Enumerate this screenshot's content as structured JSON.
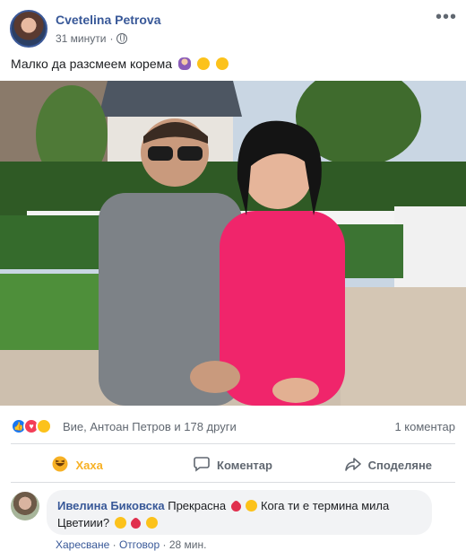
{
  "post": {
    "author": "Cvetelina Petrova",
    "time": "31 минути",
    "privacy_icon": "globe-icon",
    "more_label": "•••",
    "text": "Малко да разсмеем корема",
    "text_emojis": [
      "woman-emoji",
      "laughing-emoji",
      "grimace-emoji"
    ]
  },
  "reactions": {
    "icons": [
      "like",
      "love",
      "haha"
    ],
    "summary": "Вие, Антоан Петров и 178 други",
    "comments": "1 коментар"
  },
  "actions": {
    "haha": "Хаха",
    "comment": "Коментар",
    "share": "Споделяне"
  },
  "comment": {
    "author": "Ивелина Биковска",
    "text_a": "Прекрасна",
    "text_b": "Кога ти е термина мила Цветиии?",
    "like": "Харесване",
    "reply": "Отговор",
    "time": "28 мин.",
    "separator": "·"
  },
  "colors": {
    "link": "#385898",
    "haha_active": "#f7b125",
    "like": "#1877f2",
    "love": "#f33e58"
  }
}
